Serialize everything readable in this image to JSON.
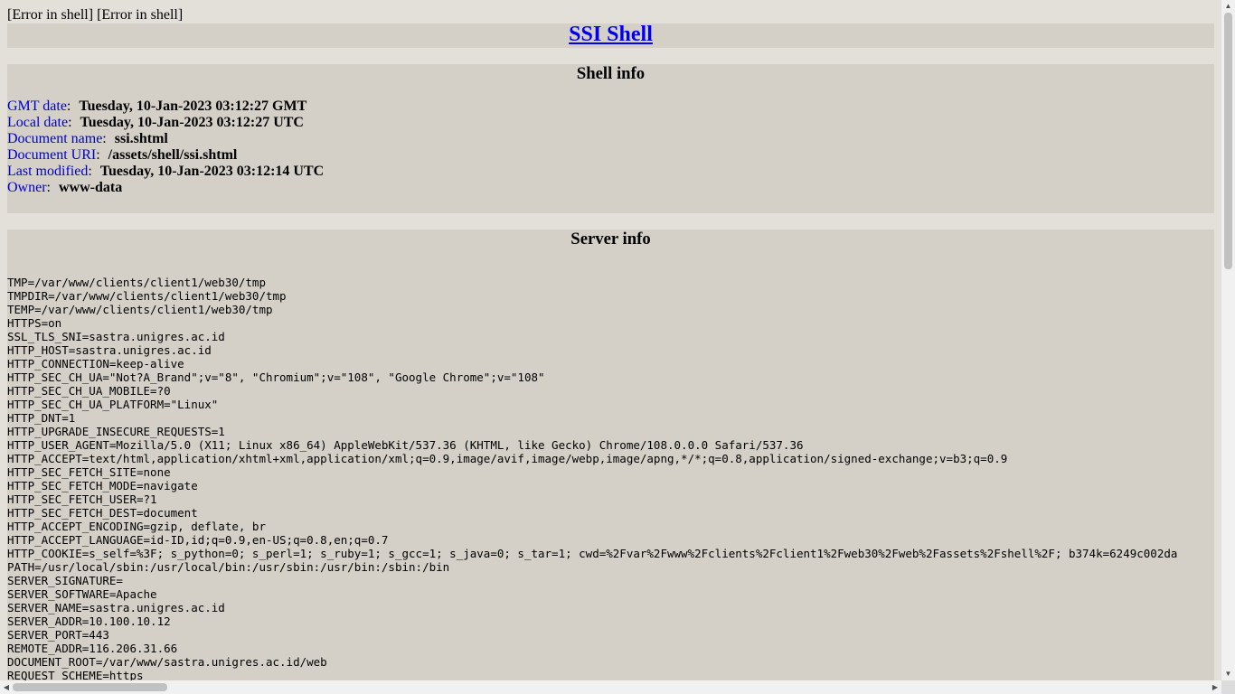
{
  "error_text": "[Error in shell] [Error in shell]",
  "title": "SSI Shell",
  "shell_info": {
    "heading": "Shell info",
    "rows": [
      {
        "key": "GMT date",
        "value": "Tuesday, 10-Jan-2023 03:12:27 GMT"
      },
      {
        "key": "Local date",
        "value": "Tuesday, 10-Jan-2023 03:12:27 UTC"
      },
      {
        "key": "Document name",
        "value": "ssi.shtml"
      },
      {
        "key": "Document URI",
        "value": "/assets/shell/ssi.shtml"
      },
      {
        "key": "Last modified",
        "value": "Tuesday, 10-Jan-2023 03:12:14 UTC"
      },
      {
        "key": "Owner",
        "value": "www-data"
      }
    ]
  },
  "server_info": {
    "heading": "Server info",
    "env_lines": [
      "TMP=/var/www/clients/client1/web30/tmp",
      "TMPDIR=/var/www/clients/client1/web30/tmp",
      "TEMP=/var/www/clients/client1/web30/tmp",
      "HTTPS=on",
      "SSL_TLS_SNI=sastra.unigres.ac.id",
      "HTTP_HOST=sastra.unigres.ac.id",
      "HTTP_CONNECTION=keep-alive",
      "HTTP_SEC_CH_UA=\"Not?A_Brand\";v=\"8\", \"Chromium\";v=\"108\", \"Google Chrome\";v=\"108\"",
      "HTTP_SEC_CH_UA_MOBILE=?0",
      "HTTP_SEC_CH_UA_PLATFORM=\"Linux\"",
      "HTTP_DNT=1",
      "HTTP_UPGRADE_INSECURE_REQUESTS=1",
      "HTTP_USER_AGENT=Mozilla/5.0 (X11; Linux x86_64) AppleWebKit/537.36 (KHTML, like Gecko) Chrome/108.0.0.0 Safari/537.36",
      "HTTP_ACCEPT=text/html,application/xhtml+xml,application/xml;q=0.9,image/avif,image/webp,image/apng,*/*;q=0.8,application/signed-exchange;v=b3;q=0.9",
      "HTTP_SEC_FETCH_SITE=none",
      "HTTP_SEC_FETCH_MODE=navigate",
      "HTTP_SEC_FETCH_USER=?1",
      "HTTP_SEC_FETCH_DEST=document",
      "HTTP_ACCEPT_ENCODING=gzip, deflate, br",
      "HTTP_ACCEPT_LANGUAGE=id-ID,id;q=0.9,en-US;q=0.8,en;q=0.7",
      "HTTP_COOKIE=s_self=%3F; s_python=0; s_perl=1; s_ruby=1; s_gcc=1; s_java=0; s_tar=1; cwd=%2Fvar%2Fwww%2Fclients%2Fclient1%2Fweb30%2Fweb%2Fassets%2Fshell%2F; b374k=6249c002da",
      "PATH=/usr/local/sbin:/usr/local/bin:/usr/sbin:/usr/bin:/sbin:/bin",
      "SERVER_SIGNATURE=",
      "SERVER_SOFTWARE=Apache",
      "SERVER_NAME=sastra.unigres.ac.id",
      "SERVER_ADDR=10.100.10.12",
      "SERVER_PORT=443",
      "REMOTE_ADDR=116.206.31.66",
      "DOCUMENT_ROOT=/var/www/sastra.unigres.ac.id/web",
      "REQUEST_SCHEME=https"
    ]
  },
  "icons": {
    "scroll_up": "triangle-up-icon",
    "scroll_down": "triangle-down-icon",
    "scroll_left": "triangle-left-icon",
    "scroll_right": "triangle-right-icon"
  }
}
